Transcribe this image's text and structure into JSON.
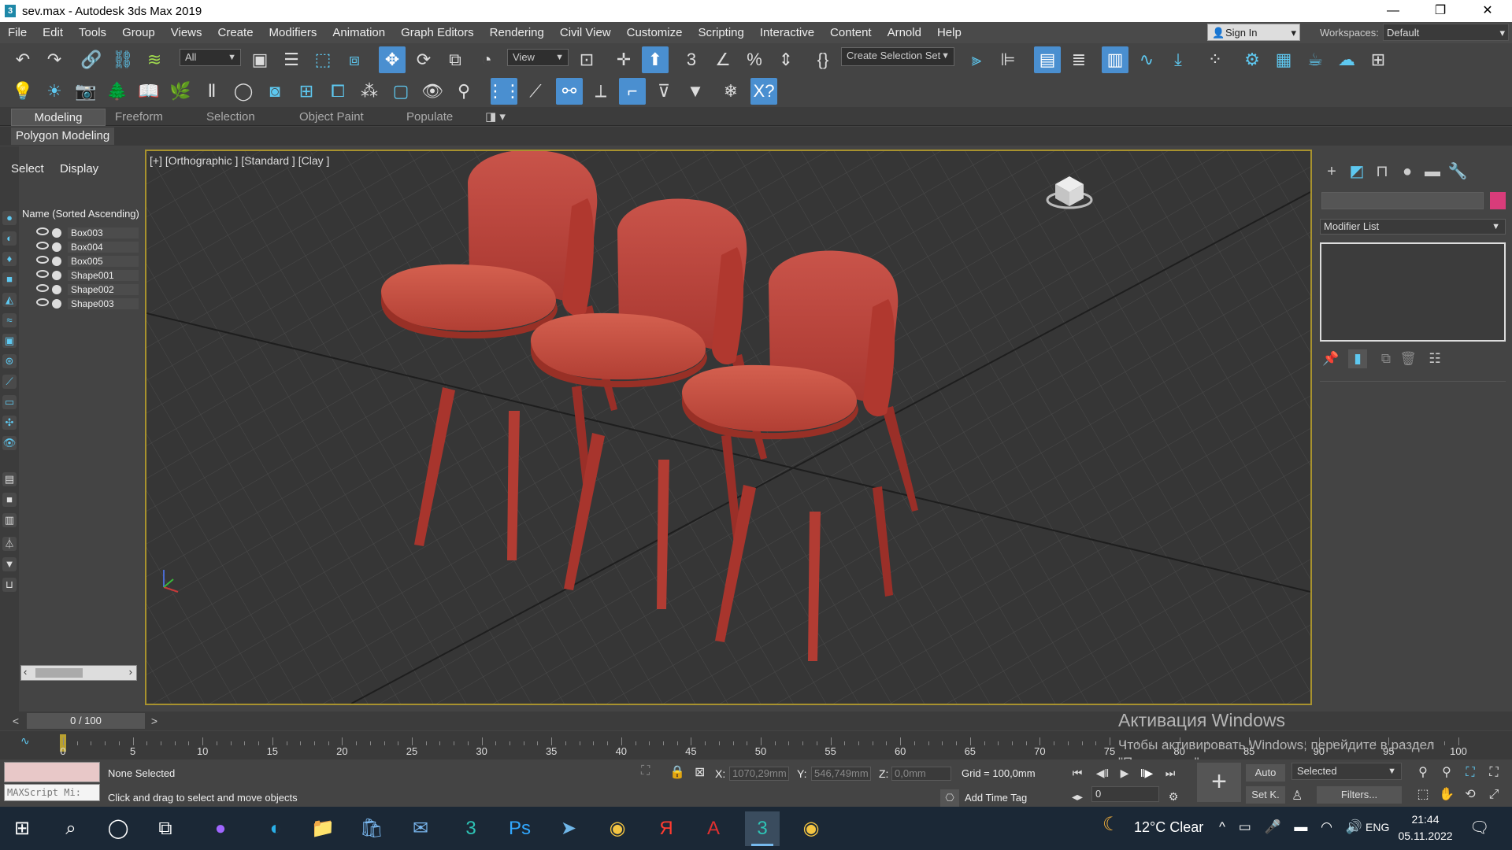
{
  "window": {
    "title": "sev.max - Autodesk 3ds Max 2019",
    "app_icon": "3"
  },
  "menu": [
    "File",
    "Edit",
    "Tools",
    "Group",
    "Views",
    "Create",
    "Modifiers",
    "Animation",
    "Graph Editors",
    "Rendering",
    "Civil View",
    "Customize",
    "Scripting",
    "Interactive",
    "Content",
    "Arnold",
    "Help"
  ],
  "account": {
    "sign_in": "Sign In",
    "workspaces_label": "Workspaces:",
    "workspace": "Default"
  },
  "toolbar": {
    "filter": "All",
    "ref_coord": "View",
    "selection_set": "Create Selection Set"
  },
  "ribbon": {
    "tabs": [
      "Modeling",
      "Freeform",
      "Selection",
      "Object Paint",
      "Populate"
    ],
    "active": "Modeling",
    "panel": "Polygon Modeling"
  },
  "explorer": {
    "tabs": [
      "Select",
      "Display"
    ],
    "header": "Name (Sorted Ascending)",
    "items": [
      "Box003",
      "Box004",
      "Box005",
      "Shape001",
      "Shape002",
      "Shape003"
    ]
  },
  "viewport": {
    "label": "[+] [Orthographic ] [Standard ] [Clay ]",
    "object_color": "#c0453a"
  },
  "command_panel": {
    "modifier_list": "Modifier List",
    "color_swatch": "#d83c7a"
  },
  "time": {
    "frame": "0 / 100",
    "ticks": [
      "0",
      "5",
      "10",
      "15",
      "20",
      "25",
      "30",
      "35",
      "40",
      "45",
      "50",
      "55",
      "60",
      "65",
      "70",
      "75",
      "80",
      "85",
      "90",
      "95",
      "100"
    ]
  },
  "windows_activation": {
    "title": "Активация Windows",
    "message": "Чтобы активировать Windows, перейдите в раздел \"Параметры\"."
  },
  "status": {
    "maxscript": "MAXScript Mi:",
    "selection": "None Selected",
    "hint": "Click and drag to select and move objects",
    "x_label": "X:",
    "x": "1070,29mm",
    "y_label": "Y:",
    "y": "546,749mm",
    "z_label": "Z:",
    "z": "0,0mm",
    "grid": "Grid = 100,0mm",
    "add_time_tag": "Add Time Tag"
  },
  "animation": {
    "auto": "Auto",
    "set_key": "Set K.",
    "key_mode": "Selected",
    "filters": "Filters...",
    "frame_input": "0"
  },
  "taskbar": {
    "weather": "12°C  Clear",
    "lang": "ENG",
    "time": "21:44",
    "date": "05.11.2022"
  }
}
